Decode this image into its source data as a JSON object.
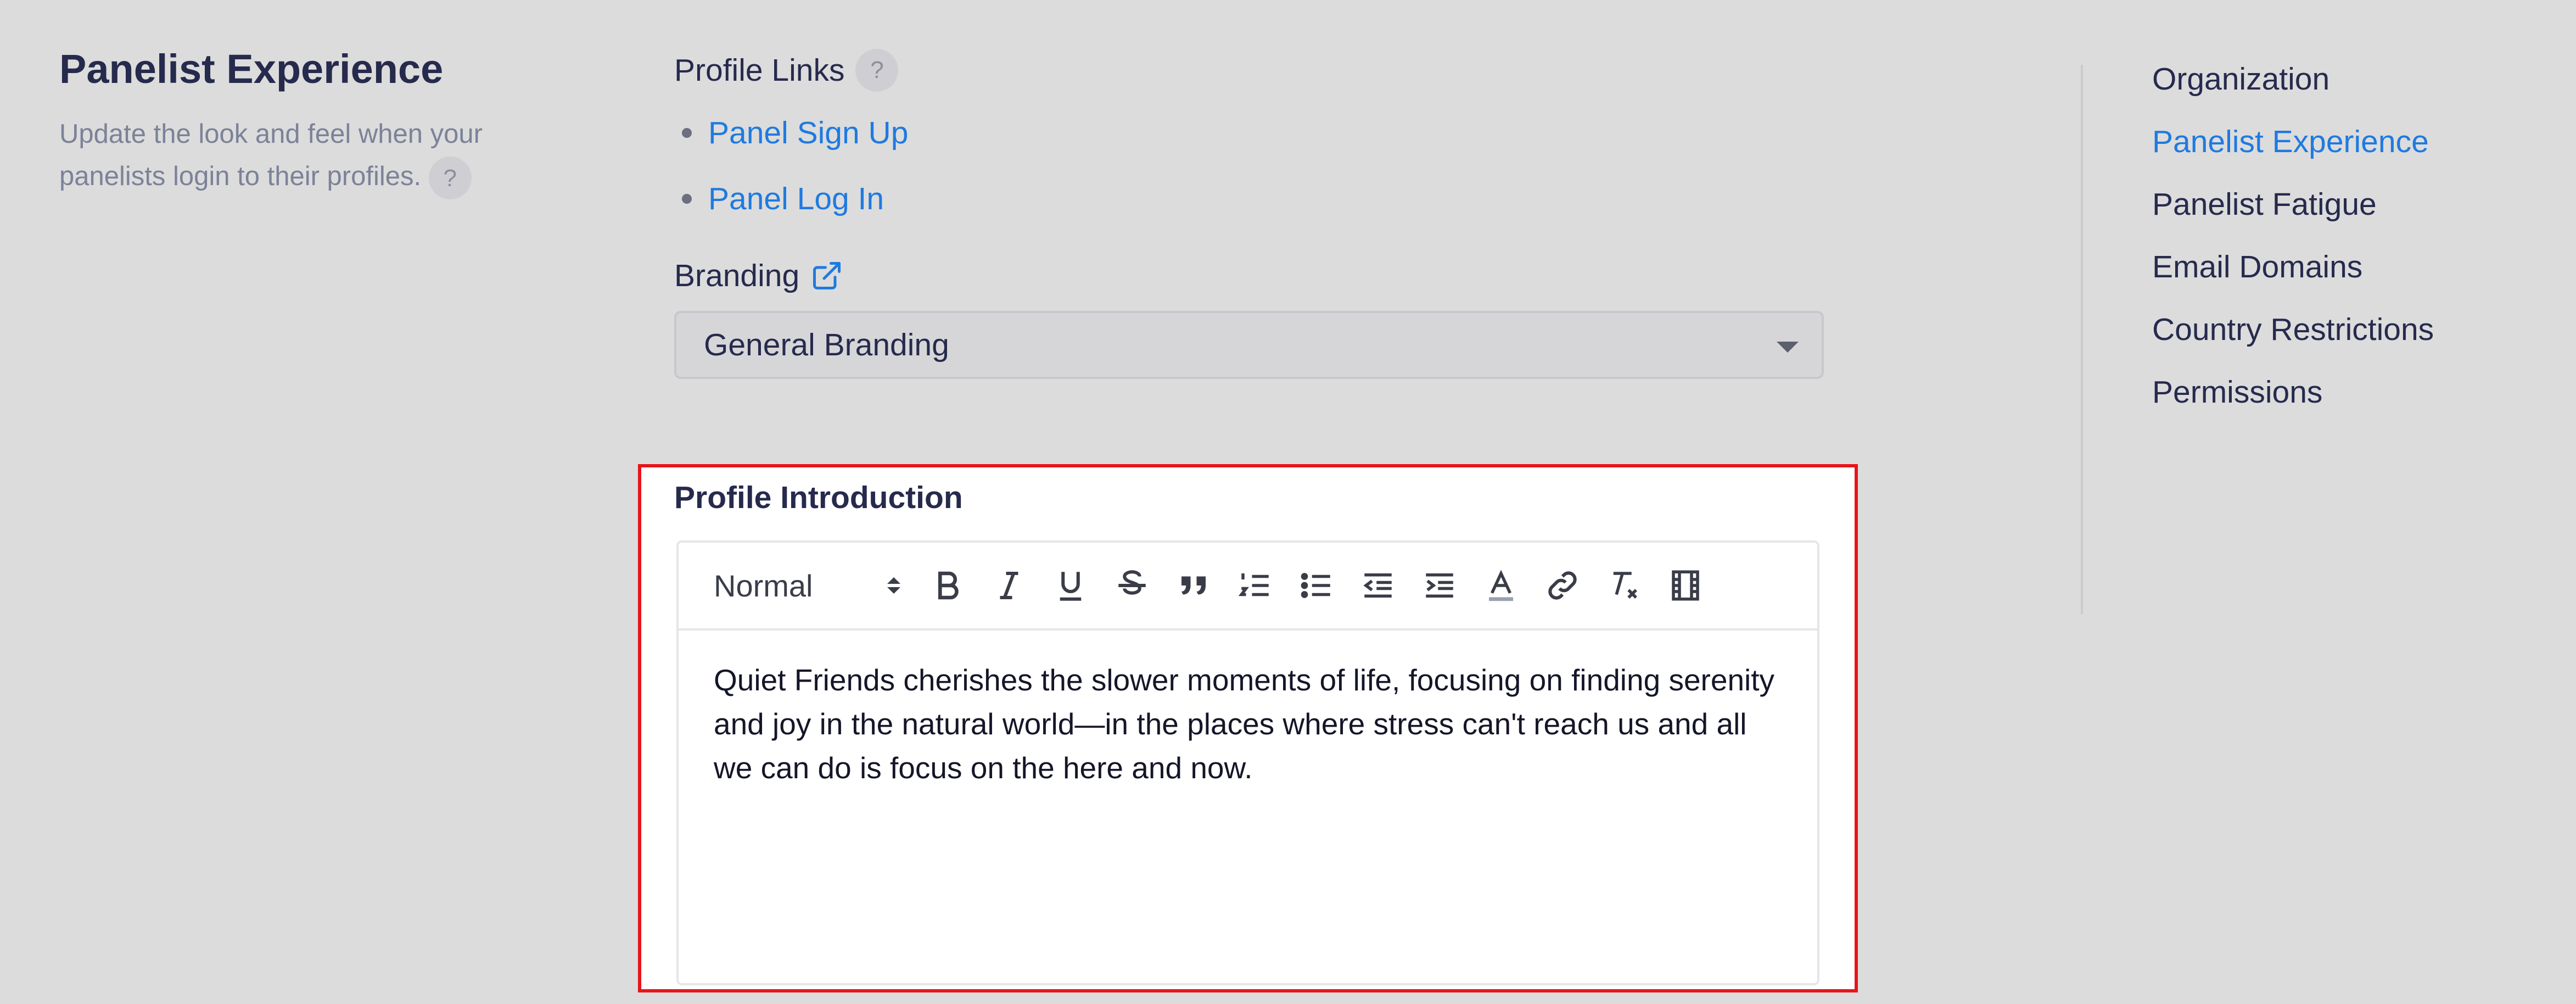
{
  "left": {
    "title": "Panelist Experience",
    "description": "Update the look and feel when your panelists login to their profiles.",
    "help": "?"
  },
  "profile_links": {
    "label": "Profile Links",
    "help": "?",
    "links": [
      "Panel Sign Up",
      "Panel Log In"
    ]
  },
  "branding": {
    "label": "Branding",
    "selected": "General Branding"
  },
  "profile_intro": {
    "label": "Profile Introduction",
    "format": "Normal",
    "content": "Quiet Friends cherishes the slower moments of life, focusing on finding serenity and joy in the natural world—in the places where stress can't reach us and all we can do is focus on the here and now."
  },
  "side_nav": {
    "items": [
      "Organization",
      "Panelist Experience",
      "Panelist Fatigue",
      "Email Domains",
      "Country Restrictions",
      "Permissions"
    ],
    "active_index": 1
  },
  "colors": {
    "accent": "#1f7ae0",
    "highlight": "#e8141b",
    "background": "#dcdcdc"
  }
}
